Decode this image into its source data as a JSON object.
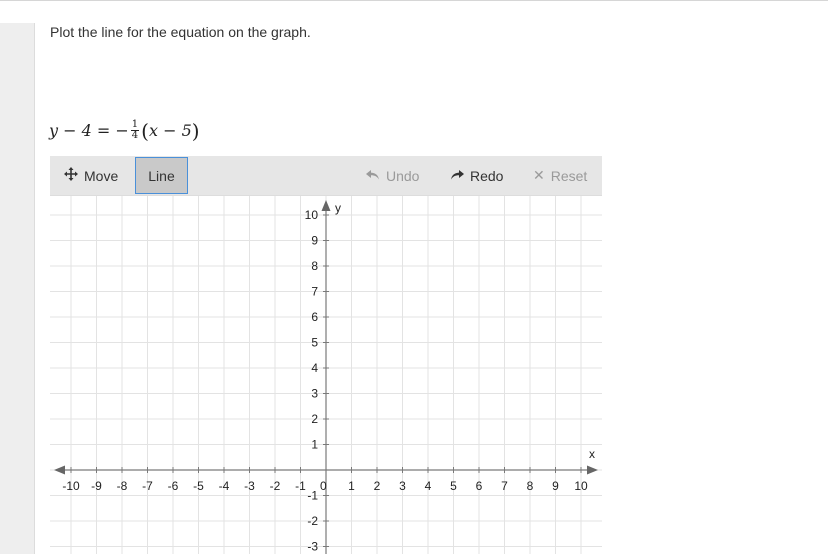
{
  "prompt": "Plot the line for the equation on the graph.",
  "equation": {
    "lhs": "y − 4 = −",
    "frac_num": "1",
    "frac_den": "4",
    "paren_open": "(",
    "inner": "x − 5",
    "paren_close": ")"
  },
  "toolbar": {
    "move_label": "Move",
    "line_label": "Line",
    "undo_label": "Undo",
    "redo_label": "Redo",
    "reset_label": "Reset",
    "active_tool": "Line",
    "undo_enabled": false,
    "redo_enabled": true,
    "reset_enabled": false
  },
  "graph": {
    "x_label": "x",
    "y_label": "y",
    "x_range": [
      -10,
      10
    ],
    "y_range": [
      -10,
      10
    ],
    "x_ticks": [
      "-10",
      "-9",
      "-8",
      "-7",
      "-6",
      "-5",
      "-4",
      "-3",
      "-2",
      "-1",
      "1",
      "2",
      "3",
      "4",
      "5",
      "6",
      "7",
      "8",
      "9",
      "10"
    ],
    "y_ticks": [
      "10",
      "9",
      "8",
      "7",
      "6",
      "5",
      "4",
      "3",
      "2",
      "1",
      "-1",
      "-2",
      "-3"
    ],
    "origin_label": "0",
    "grid": true,
    "grid_color": "#e3e3e3",
    "axis_color": "#7a7a7a"
  }
}
